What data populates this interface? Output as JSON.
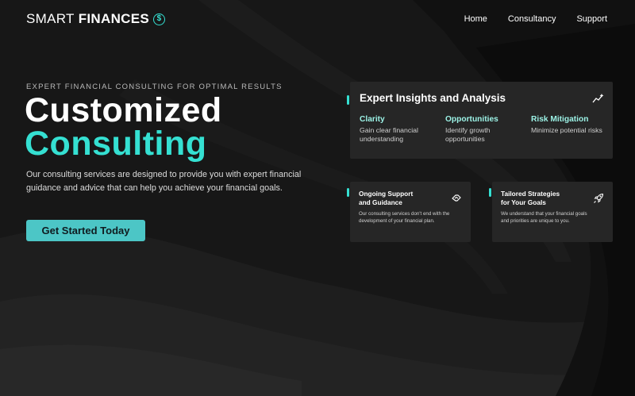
{
  "brand": {
    "light": "SMART",
    "bold": "FINANCES",
    "icon": "dollar-circle-icon",
    "accent_color": "#35e0d2"
  },
  "nav": {
    "items": [
      "Home",
      "Consultancy",
      "Support"
    ]
  },
  "hero": {
    "eyebrow": "EXPERT FINANCIAL CONSULTING FOR OPTIMAL RESULTS",
    "title_line1": "Customized",
    "title_line2": "Consulting",
    "description": "Our consulting services are designed to provide you with expert financial guidance and advice that can help you achieve your financial goals.",
    "cta_label": "Get Started Today"
  },
  "insights_card": {
    "title": "Expert Insights and Analysis",
    "icon": "sparkle-chart-icon",
    "features": [
      {
        "heading": "Clarity",
        "text": "Gain clear financial understanding"
      },
      {
        "heading": "Opportunities",
        "text": "Identify growth opportunities"
      },
      {
        "heading": "Risk Mitigation",
        "text": "Minimize potential risks"
      }
    ]
  },
  "support_card": {
    "title_line1": "Ongoing Support",
    "title_line2": "and Guidance",
    "text": "Our consulting services don't end with the development of your financial plan.",
    "icon": "handshake-icon"
  },
  "strategies_card": {
    "title_line1": "Tailored Strategies",
    "title_line2": "for Your Goals",
    "text": "We understand that your financial goals and priorities are unique to you.",
    "icon": "rocket-icon"
  },
  "colors": {
    "background": "#161616",
    "card": "#262626",
    "accent": "#35e0d2",
    "button": "#4cc6c6"
  }
}
